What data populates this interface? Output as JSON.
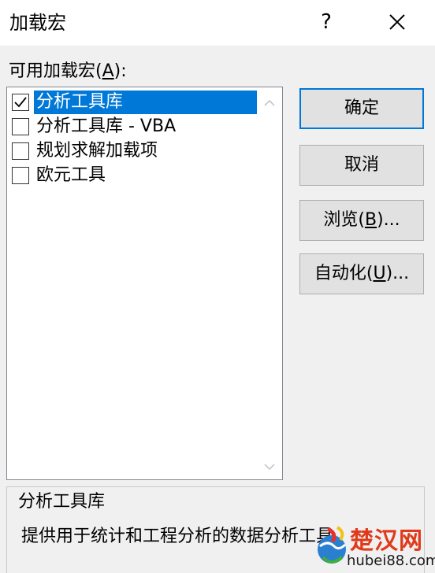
{
  "window": {
    "title": "加载宏",
    "help_label": "?",
    "close_icon": "close-icon"
  },
  "addins": {
    "label": "可用加载宏(A):",
    "label_prefix": "可用加载宏(",
    "label_mnemonic": "A",
    "label_suffix": "):",
    "items": [
      {
        "label": "分析工具库",
        "checked": true,
        "selected": true
      },
      {
        "label": "分析工具库 - VBA",
        "checked": false,
        "selected": false
      },
      {
        "label": "规划求解加载项",
        "checked": false,
        "selected": false
      },
      {
        "label": "欧元工具",
        "checked": false,
        "selected": false
      }
    ]
  },
  "buttons": {
    "ok": "确定",
    "cancel": "取消",
    "browse": {
      "label": "浏览(B)...",
      "prefix": "浏览(",
      "mnemonic": "B",
      "suffix": ")..."
    },
    "automation": {
      "label": "自动化(U)...",
      "prefix": "自动化(",
      "mnemonic": "U",
      "suffix": ")..."
    }
  },
  "description": {
    "title": "分析工具库",
    "text": "提供用于统计和工程分析的数据分析工具"
  },
  "watermark": {
    "text": "楚汉网",
    "url": "hubei88.com"
  },
  "colors": {
    "selection": "#0078d7",
    "window_bg": "#f0f0f0",
    "watermark_red": "#e03a1a"
  }
}
